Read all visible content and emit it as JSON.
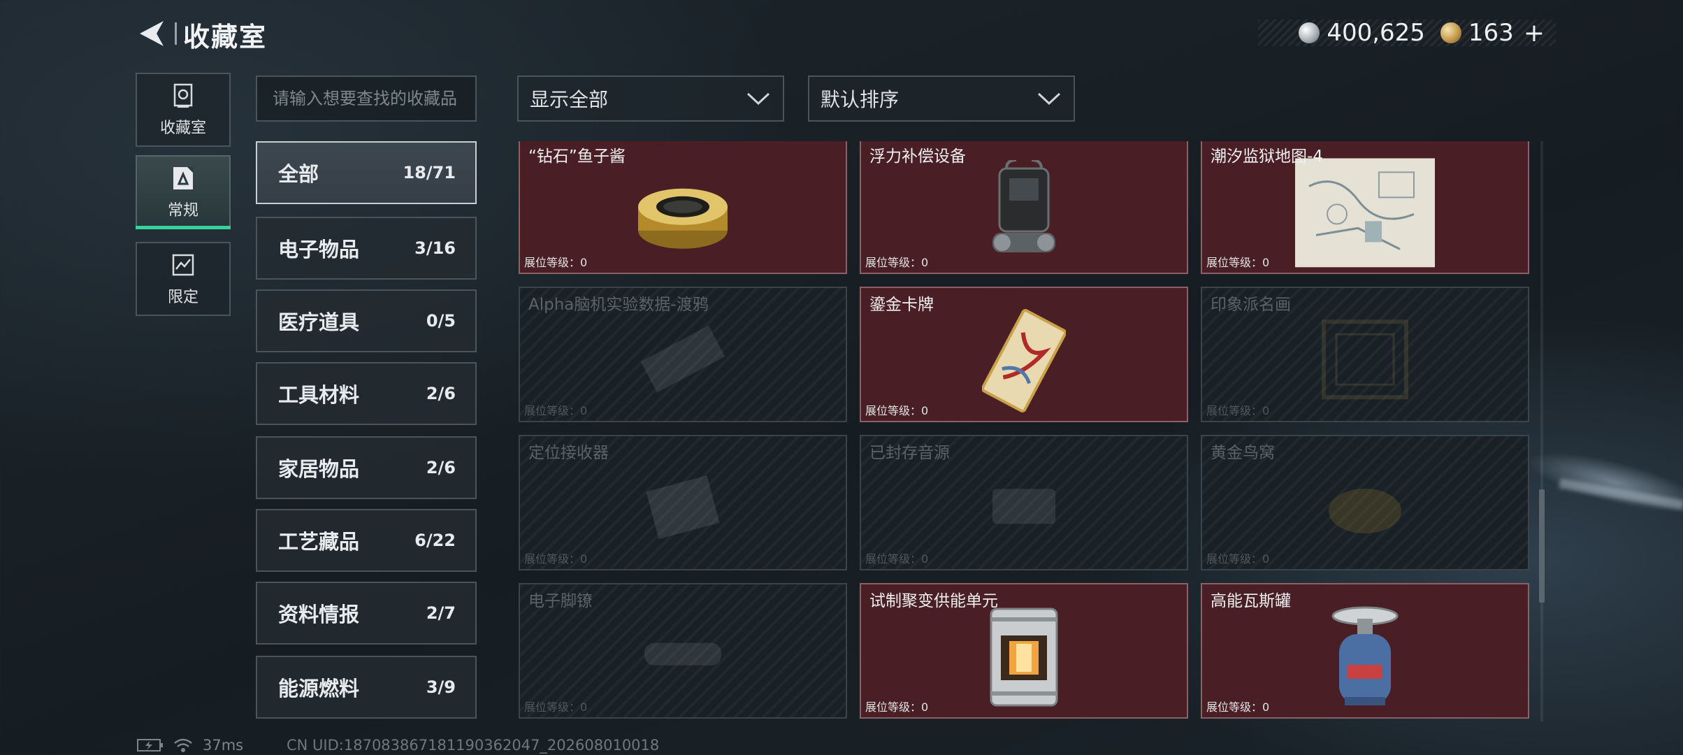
{
  "header": {
    "title": "收藏室"
  },
  "currency": {
    "silver": {
      "icon": "silver-coin-icon",
      "value": "400,625"
    },
    "gold": {
      "icon": "gold-coin-icon",
      "value": "163"
    },
    "plus": "+"
  },
  "rail": [
    {
      "label": "收藏室",
      "icon": "vault-icon",
      "active": false
    },
    {
      "label": "常规",
      "icon": "regular-collection-icon",
      "active": true
    },
    {
      "label": "限定",
      "icon": "limited-collection-icon",
      "active": false
    }
  ],
  "search": {
    "placeholder": "请输入想要查找的收藏品"
  },
  "filters": {
    "show": "显示全部",
    "sort": "默认排序"
  },
  "categories": [
    {
      "name": "全部",
      "count": "18/71",
      "active": true
    },
    {
      "name": "电子物品",
      "count": "3/16"
    },
    {
      "name": "医疗道具",
      "count": "0/5"
    },
    {
      "name": "工具材料",
      "count": "2/6"
    },
    {
      "name": "家居物品",
      "count": "2/6"
    },
    {
      "name": "工艺藏品",
      "count": "6/22"
    },
    {
      "name": "资料情报",
      "count": "2/7"
    },
    {
      "name": "能源燃料",
      "count": "3/9"
    }
  ],
  "level_label": "展位等级：0",
  "items": [
    {
      "name": "“钻石”鱼子酱",
      "owned": true,
      "icon": "caviar-tin-icon"
    },
    {
      "name": "浮力补偿设备",
      "owned": true,
      "icon": "buoyancy-device-icon"
    },
    {
      "name": "潮汐监狱地图-4",
      "owned": true,
      "icon": "map-icon"
    },
    {
      "name": "Alpha脑机实验数据-渡鸦",
      "owned": false,
      "icon": "data-drive-icon"
    },
    {
      "name": "鎏金卡牌",
      "owned": true,
      "icon": "gilded-card-icon"
    },
    {
      "name": "印象派名画",
      "owned": false,
      "icon": "painting-icon"
    },
    {
      "name": "定位接收器",
      "owned": false,
      "icon": "receiver-icon"
    },
    {
      "name": "已封存音源",
      "owned": false,
      "icon": "sealed-audio-icon"
    },
    {
      "name": "黄金鸟窝",
      "owned": false,
      "icon": "golden-nest-icon"
    },
    {
      "name": "电子脚镣",
      "owned": false,
      "icon": "ankle-monitor-icon"
    },
    {
      "name": "试制聚变供能单元",
      "owned": true,
      "icon": "fusion-cell-icon"
    },
    {
      "name": "高能瓦斯罐",
      "owned": true,
      "icon": "gas-canister-icon"
    }
  ],
  "status": {
    "ping": "37ms",
    "uid": "CN UID:18708386718119036204​7_202608010018"
  }
}
